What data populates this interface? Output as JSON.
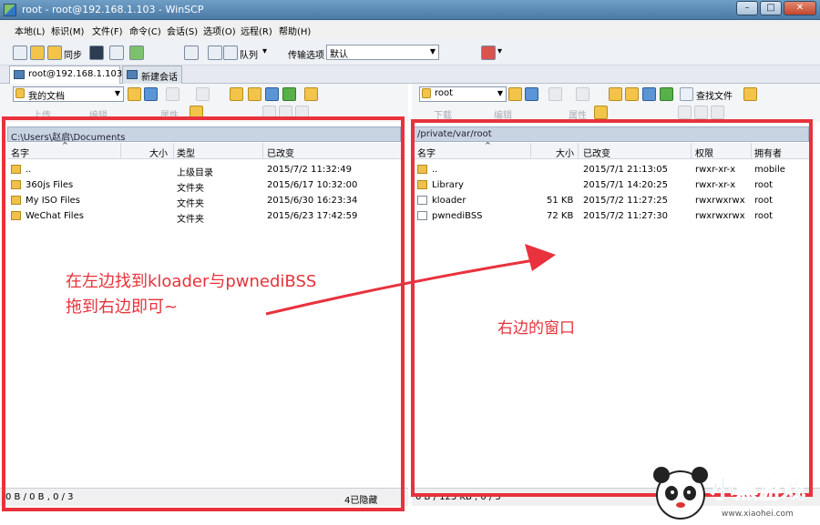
{
  "window": {
    "title": "root - root@192.168.1.103 - WinSCP",
    "btn_min": "–",
    "btn_max": "□",
    "btn_close": "✕"
  },
  "menubar": [
    "本地(L)",
    "标识(M)",
    "文件(F)",
    "命令(C)",
    "会话(S)",
    "选项(O)",
    "远程(R)",
    "帮助(H)"
  ],
  "toolbar": {
    "sync_label": "同步",
    "queue_label": "队列",
    "transfer_label": "传输选项",
    "transfer_value": "默认"
  },
  "tabs": {
    "session": "root@192.168.1.103",
    "new_session": "新建会话"
  },
  "left": {
    "location": "我的文档",
    "path": "C:\\Users\\赵启\\Documents",
    "actions": [
      "上传",
      "编辑",
      "属性"
    ],
    "columns": [
      "名字",
      "大小",
      "类型",
      "已改变"
    ],
    "rows": [
      {
        "name": "..",
        "size": "",
        "type": "上级目录",
        "changed": "2015/7/2  11:32:49"
      },
      {
        "name": "360js Files",
        "size": "",
        "type": "文件夹",
        "changed": "2015/6/17  10:32:00"
      },
      {
        "name": "My ISO Files",
        "size": "",
        "type": "文件夹",
        "changed": "2015/6/30  16:23:34"
      },
      {
        "name": "WeChat Files",
        "size": "",
        "type": "文件夹",
        "changed": "2015/6/23  17:42:59"
      }
    ],
    "status_left": "0 B / 0 B , 0 / 3",
    "status_right": "4已隐藏"
  },
  "right": {
    "location": "root",
    "path": "/private/var/root",
    "find_label": "查找文件",
    "actions": [
      "下载",
      "编辑",
      "属性"
    ],
    "columns": [
      "名字",
      "大小",
      "已改变",
      "权限",
      "拥有者"
    ],
    "rows": [
      {
        "name": "..",
        "size": "",
        "changed": "2015/7/1 21:13:05",
        "perm": "rwxr-xr-x",
        "owner": "mobile"
      },
      {
        "name": "Library",
        "size": "",
        "changed": "2015/7/1 14:20:25",
        "perm": "rwxr-xr-x",
        "owner": "root"
      },
      {
        "name": "kloader",
        "size": "51 KB",
        "changed": "2015/7/2 11:27:25",
        "perm": "rwxrwxrwx",
        "owner": "root"
      },
      {
        "name": "pwnediBSS",
        "size": "72 KB",
        "changed": "2015/7/2 11:27:30",
        "perm": "rwxrwxrwx",
        "owner": "root"
      }
    ],
    "status_left": "0 B / 123 KB , 0 / 3"
  },
  "annotations": {
    "left_line1": "在左边找到kloader与pwnediBSS",
    "left_line2": "拖到右边即可~",
    "right": "右边的窗口",
    "color": "#e8323d"
  },
  "watermark": {
    "word": "小黑游戏",
    "url": "www.xiaohei.com"
  }
}
